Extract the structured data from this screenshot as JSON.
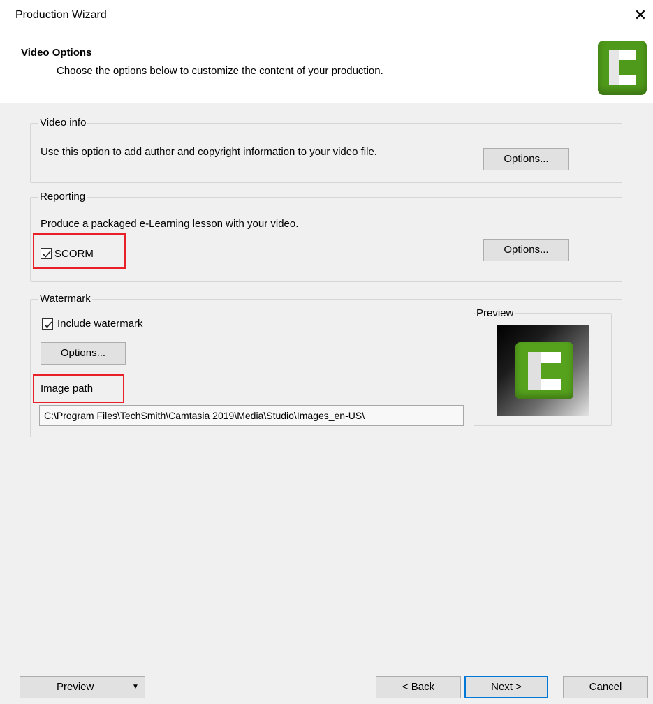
{
  "window": {
    "title": "Production Wizard",
    "close_glyph": "✕"
  },
  "header": {
    "title": "Video Options",
    "subtitle": "Choose the options below to customize the content of your production.",
    "logo_icon": "camtasia-logo-icon"
  },
  "video_info": {
    "legend": "Video info",
    "description": "Use this option to add author and copyright information to your video file.",
    "options_label": "Options..."
  },
  "reporting": {
    "legend": "Reporting",
    "description": "Produce a packaged e-Learning lesson with your video.",
    "scorm_label": "SCORM",
    "scorm_checked": true,
    "options_label": "Options..."
  },
  "watermark": {
    "legend": "Watermark",
    "include_label": "Include watermark",
    "include_checked": true,
    "options_label": "Options...",
    "image_path_label": "Image path",
    "image_path_value": "C:\\Program Files\\TechSmith\\Camtasia 2019\\Media\\Studio\\Images_en-US\\",
    "preview_legend": "Preview"
  },
  "footer": {
    "preview_label": "Preview",
    "preview_arrow": "▼",
    "back_label": "< Back",
    "next_label": "Next >",
    "cancel_label": "Cancel"
  },
  "colors": {
    "highlight": "#e8202a",
    "accent": "#0078d7",
    "logo_green": "#4f9a1a"
  }
}
